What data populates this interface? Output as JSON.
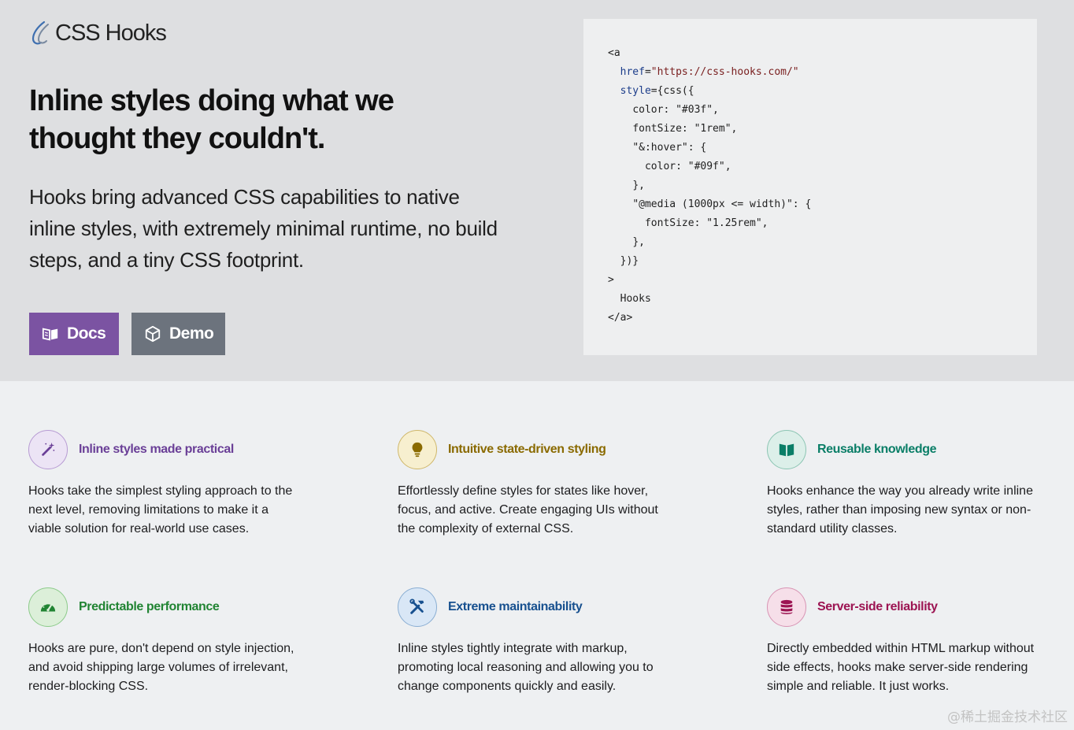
{
  "brand": {
    "name": "CSS Hooks",
    "logo_icon": "hook-logo-icon"
  },
  "hero": {
    "headline": "Inline styles doing what we thought they couldn't.",
    "subhead": "Hooks bring advanced CSS capabilities to native inline styles, with extremely minimal runtime, no build steps, and a tiny CSS footprint.",
    "docs_label": "Docs",
    "demo_label": "Demo",
    "docs_icon": "book-icon",
    "demo_icon": "cube-icon"
  },
  "code": {
    "lines": [
      {
        "indent": 0,
        "parts": [
          {
            "t": "<a"
          }
        ]
      },
      {
        "indent": 1,
        "parts": [
          {
            "t": "href",
            "k": "attr"
          },
          {
            "t": "="
          },
          {
            "t": "\"https://css-hooks.com/\"",
            "k": "str"
          }
        ]
      },
      {
        "indent": 1,
        "parts": [
          {
            "t": "style",
            "k": "attr"
          },
          {
            "t": "={css({"
          }
        ]
      },
      {
        "indent": 2,
        "parts": [
          {
            "t": "color: \"#03f\","
          }
        ]
      },
      {
        "indent": 2,
        "parts": [
          {
            "t": "fontSize: \"1rem\","
          }
        ]
      },
      {
        "indent": 2,
        "parts": [
          {
            "t": "\"&:hover\": {"
          }
        ]
      },
      {
        "indent": 3,
        "parts": [
          {
            "t": "color: \"#09f\","
          }
        ]
      },
      {
        "indent": 2,
        "parts": [
          {
            "t": "},"
          }
        ]
      },
      {
        "indent": 2,
        "parts": [
          {
            "t": "\"@media (1000px <= width)\": {"
          }
        ]
      },
      {
        "indent": 3,
        "parts": [
          {
            "t": "fontSize: \"1.25rem\","
          }
        ]
      },
      {
        "indent": 2,
        "parts": [
          {
            "t": "},"
          }
        ]
      },
      {
        "indent": 1,
        "parts": [
          {
            "t": "})}"
          }
        ]
      },
      {
        "indent": 0,
        "parts": [
          {
            "t": ">"
          }
        ]
      },
      {
        "indent": 1,
        "parts": [
          {
            "t": "Hooks"
          }
        ]
      },
      {
        "indent": 0,
        "parts": [
          {
            "t": "</a>"
          }
        ]
      }
    ]
  },
  "features": [
    {
      "title": "Inline styles made practical",
      "icon": "magic-wand-icon",
      "color": "#6a3f97",
      "desc": "Hooks take the simplest styling approach to the next level, removing limitations to make it a viable solution for real-world use cases."
    },
    {
      "title": "Intuitive state-driven styling",
      "icon": "lightbulb-icon",
      "color": "#8a6a00",
      "desc": "Effortlessly define styles for states like hover, focus, and active. Create engaging UIs without the complexity of external CSS."
    },
    {
      "title": "Reusable knowledge",
      "icon": "open-book-icon",
      "color": "#0a7e67",
      "desc": "Hooks enhance the way you already write inline styles, rather than imposing new syntax or non-standard utility classes."
    },
    {
      "title": "Predictable performance",
      "icon": "gauge-icon",
      "color": "#218433",
      "desc": "Hooks are pure, don't depend on style injection, and avoid shipping large volumes of irrelevant, render-blocking CSS."
    },
    {
      "title": "Extreme maintainability",
      "icon": "tools-icon",
      "color": "#17508f",
      "desc": "Inline styles tightly integrate with markup, promoting local reasoning and allowing you to change components quickly and easily."
    },
    {
      "title": "Server-side reliability",
      "icon": "database-icon",
      "color": "#9c1452",
      "desc": "Directly embedded within HTML markup without side effects, hooks make server-side rendering simple and reliable. It just works."
    }
  ],
  "watermark": "@稀土掘金技术社区"
}
